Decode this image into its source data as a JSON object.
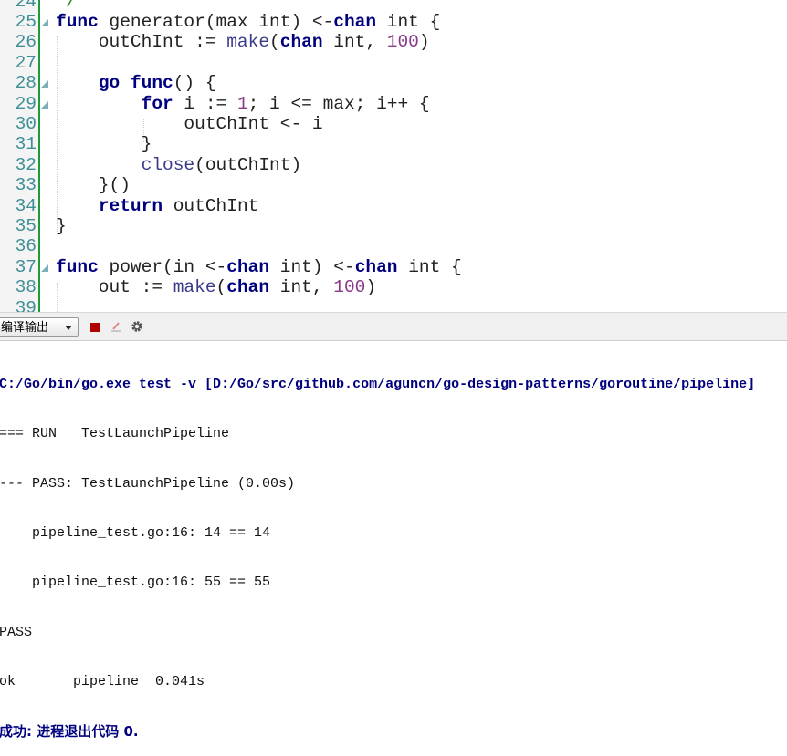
{
  "editor": {
    "lines": [
      {
        "num": "24",
        "fold": false,
        "tokens": [
          [
            "  */",
            "cm"
          ]
        ]
      },
      {
        "num": "25",
        "fold": true,
        "tokens": [
          [
            "func",
            "kw"
          ],
          [
            " generator(max int) <-",
            ""
          ],
          [
            "chan",
            "kw"
          ],
          [
            " int {",
            ""
          ]
        ]
      },
      {
        "num": "26",
        "fold": false,
        "tokens": [
          [
            "    outChInt := ",
            ""
          ],
          [
            "make",
            "bi"
          ],
          [
            "(",
            ""
          ],
          [
            "chan",
            "kw"
          ],
          [
            " int, ",
            ""
          ],
          [
            "100",
            "num"
          ],
          [
            ")",
            ""
          ]
        ]
      },
      {
        "num": "27",
        "fold": false,
        "tokens": []
      },
      {
        "num": "28",
        "fold": true,
        "tokens": [
          [
            "    ",
            ""
          ],
          [
            "go",
            "kw"
          ],
          [
            " ",
            ""
          ],
          [
            "func",
            "kw"
          ],
          [
            "() {",
            ""
          ]
        ]
      },
      {
        "num": "29",
        "fold": true,
        "tokens": [
          [
            "        ",
            ""
          ],
          [
            "for",
            "kw"
          ],
          [
            " i := ",
            ""
          ],
          [
            "1",
            "num"
          ],
          [
            "; i <= max; i++ {",
            ""
          ]
        ]
      },
      {
        "num": "30",
        "fold": false,
        "tokens": [
          [
            "            outChInt <- i",
            ""
          ]
        ]
      },
      {
        "num": "31",
        "fold": false,
        "tokens": [
          [
            "        }",
            ""
          ]
        ]
      },
      {
        "num": "32",
        "fold": false,
        "tokens": [
          [
            "        ",
            ""
          ],
          [
            "close",
            "bi"
          ],
          [
            "(outChInt)",
            ""
          ]
        ]
      },
      {
        "num": "33",
        "fold": false,
        "tokens": [
          [
            "    }()",
            ""
          ]
        ]
      },
      {
        "num": "34",
        "fold": false,
        "tokens": [
          [
            "    ",
            ""
          ],
          [
            "return",
            "kw"
          ],
          [
            " outChInt",
            ""
          ]
        ]
      },
      {
        "num": "35",
        "fold": false,
        "tokens": [
          [
            "}",
            ""
          ]
        ]
      },
      {
        "num": "36",
        "fold": false,
        "tokens": []
      },
      {
        "num": "37",
        "fold": true,
        "tokens": [
          [
            "func",
            "kw"
          ],
          [
            " power(in <-",
            ""
          ],
          [
            "chan",
            "kw"
          ],
          [
            " int) <-",
            ""
          ],
          [
            "chan",
            "kw"
          ],
          [
            " int {",
            ""
          ]
        ]
      },
      {
        "num": "38",
        "fold": false,
        "tokens": [
          [
            "    out := ",
            ""
          ],
          [
            "make",
            "bi"
          ],
          [
            "(",
            ""
          ],
          [
            "chan",
            "kw"
          ],
          [
            " int, ",
            ""
          ],
          [
            "100",
            "num"
          ],
          [
            ")",
            ""
          ]
        ]
      },
      {
        "num": "39",
        "fold": false,
        "tokens": []
      }
    ]
  },
  "toolbar": {
    "output_select": "编译输出",
    "icons": [
      "stop-icon",
      "clear-icon",
      "gear-icon"
    ]
  },
  "console": {
    "command": "C:/Go/bin/go.exe test -v [D:/Go/src/github.com/aguncn/go-design-patterns/goroutine/pipeline]",
    "lines": [
      "=== RUN   TestLaunchPipeline",
      "--- PASS: TestLaunchPipeline (0.00s)",
      "    pipeline_test.go:16: 14 == 14",
      "    pipeline_test.go:16: 55 == 55",
      "PASS",
      "ok  \t pipeline  0.041s"
    ],
    "result": "成功: 进程退出代码 0."
  }
}
